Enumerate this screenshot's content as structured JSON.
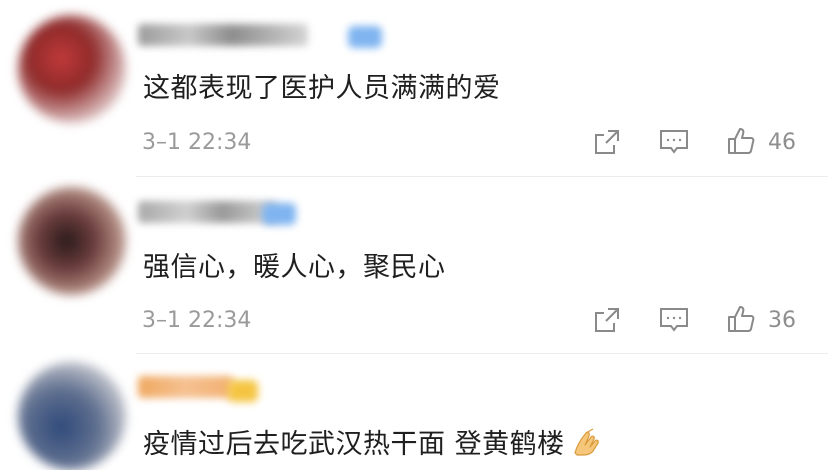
{
  "comments": [
    {
      "text": "这都表现了医护人员满满的爱",
      "time": "3–1 22:34",
      "likes": "46"
    },
    {
      "text": "强信心，暖人心，聚民心",
      "time": "3–1 22:34",
      "likes": "36"
    },
    {
      "text": "疫情过后去吃武汉热干面 登黄鹤楼",
      "emoji": "folded-hands-emoji"
    }
  ],
  "icons": {
    "share": "share-icon",
    "comment": "comment-icon",
    "like": "thumbs-up-icon"
  },
  "colors": {
    "text": "#1f1f1f",
    "meta": "#9a9a9a",
    "icon": "#8a8a8a",
    "divider": "#ececec"
  }
}
